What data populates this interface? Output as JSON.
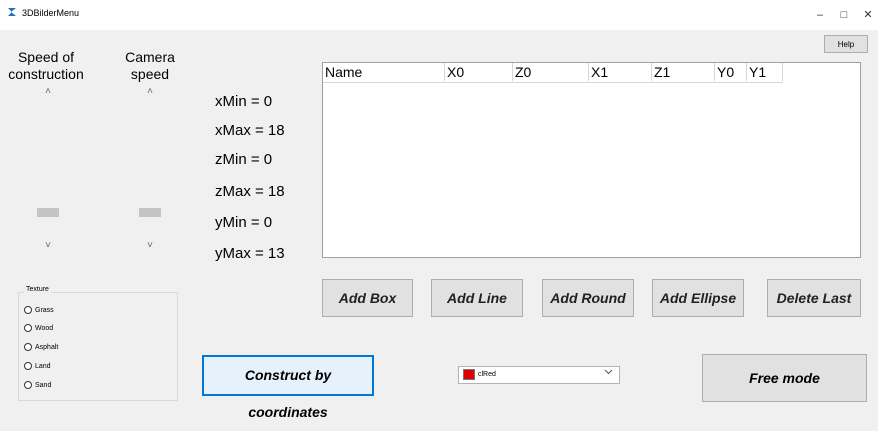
{
  "window": {
    "title": "3DBilderMenu",
    "minimize": "–",
    "maximize": "□",
    "close": "✕"
  },
  "help_label": "Help",
  "sliders": {
    "speed_label_line1": "Speed of",
    "speed_label_line2": "construction",
    "camera_label_line1": "Camera",
    "camera_label_line2": "speed",
    "up_arrow": "˄",
    "down_arrow": "˅"
  },
  "ranges": {
    "xmin": "xMin = 0",
    "xmax": "xMax = 18",
    "zmin": "zMin = 0",
    "zmax": "zMax = 18",
    "ymin": "yMin = 0",
    "ymax": "yMax = 13"
  },
  "grid": {
    "columns": [
      "Name",
      "X0",
      "Z0",
      "X1",
      "Z1",
      "Y0",
      "Y1"
    ],
    "rows": []
  },
  "actions": {
    "add_box": "Add Box",
    "add_line": "Add Line",
    "add_round": "Add Round",
    "add_ellipse": "Add Ellipse",
    "delete_last": "Delete Last"
  },
  "texture": {
    "title": "Texture",
    "options": [
      "Grass",
      "Wood",
      "Asphalt",
      "Land",
      "Sand"
    ]
  },
  "construct_label": "Construct by coordinates",
  "color_select": {
    "value": "clRed",
    "swatch_color": "#e00000"
  },
  "free_mode_label": "Free mode",
  "colors": {
    "accent": "#0078d7",
    "button_face": "#e1e1e1"
  }
}
